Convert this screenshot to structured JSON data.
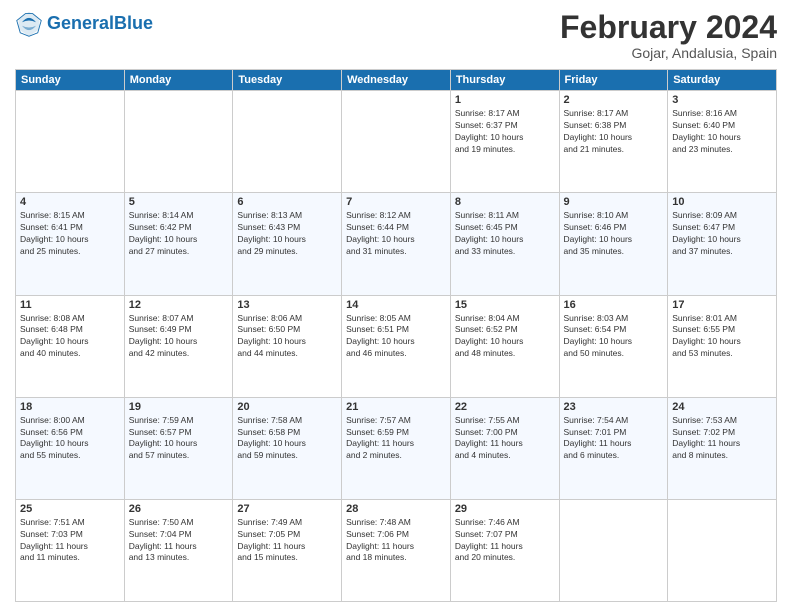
{
  "header": {
    "logo_general": "General",
    "logo_blue": "Blue",
    "month": "February 2024",
    "location": "Gojar, Andalusia, Spain"
  },
  "weekdays": [
    "Sunday",
    "Monday",
    "Tuesday",
    "Wednesday",
    "Thursday",
    "Friday",
    "Saturday"
  ],
  "rows": [
    [
      {
        "day": "",
        "info": ""
      },
      {
        "day": "",
        "info": ""
      },
      {
        "day": "",
        "info": ""
      },
      {
        "day": "",
        "info": ""
      },
      {
        "day": "1",
        "info": "Sunrise: 8:17 AM\nSunset: 6:37 PM\nDaylight: 10 hours\nand 19 minutes."
      },
      {
        "day": "2",
        "info": "Sunrise: 8:17 AM\nSunset: 6:38 PM\nDaylight: 10 hours\nand 21 minutes."
      },
      {
        "day": "3",
        "info": "Sunrise: 8:16 AM\nSunset: 6:40 PM\nDaylight: 10 hours\nand 23 minutes."
      }
    ],
    [
      {
        "day": "4",
        "info": "Sunrise: 8:15 AM\nSunset: 6:41 PM\nDaylight: 10 hours\nand 25 minutes."
      },
      {
        "day": "5",
        "info": "Sunrise: 8:14 AM\nSunset: 6:42 PM\nDaylight: 10 hours\nand 27 minutes."
      },
      {
        "day": "6",
        "info": "Sunrise: 8:13 AM\nSunset: 6:43 PM\nDaylight: 10 hours\nand 29 minutes."
      },
      {
        "day": "7",
        "info": "Sunrise: 8:12 AM\nSunset: 6:44 PM\nDaylight: 10 hours\nand 31 minutes."
      },
      {
        "day": "8",
        "info": "Sunrise: 8:11 AM\nSunset: 6:45 PM\nDaylight: 10 hours\nand 33 minutes."
      },
      {
        "day": "9",
        "info": "Sunrise: 8:10 AM\nSunset: 6:46 PM\nDaylight: 10 hours\nand 35 minutes."
      },
      {
        "day": "10",
        "info": "Sunrise: 8:09 AM\nSunset: 6:47 PM\nDaylight: 10 hours\nand 37 minutes."
      }
    ],
    [
      {
        "day": "11",
        "info": "Sunrise: 8:08 AM\nSunset: 6:48 PM\nDaylight: 10 hours\nand 40 minutes."
      },
      {
        "day": "12",
        "info": "Sunrise: 8:07 AM\nSunset: 6:49 PM\nDaylight: 10 hours\nand 42 minutes."
      },
      {
        "day": "13",
        "info": "Sunrise: 8:06 AM\nSunset: 6:50 PM\nDaylight: 10 hours\nand 44 minutes."
      },
      {
        "day": "14",
        "info": "Sunrise: 8:05 AM\nSunset: 6:51 PM\nDaylight: 10 hours\nand 46 minutes."
      },
      {
        "day": "15",
        "info": "Sunrise: 8:04 AM\nSunset: 6:52 PM\nDaylight: 10 hours\nand 48 minutes."
      },
      {
        "day": "16",
        "info": "Sunrise: 8:03 AM\nSunset: 6:54 PM\nDaylight: 10 hours\nand 50 minutes."
      },
      {
        "day": "17",
        "info": "Sunrise: 8:01 AM\nSunset: 6:55 PM\nDaylight: 10 hours\nand 53 minutes."
      }
    ],
    [
      {
        "day": "18",
        "info": "Sunrise: 8:00 AM\nSunset: 6:56 PM\nDaylight: 10 hours\nand 55 minutes."
      },
      {
        "day": "19",
        "info": "Sunrise: 7:59 AM\nSunset: 6:57 PM\nDaylight: 10 hours\nand 57 minutes."
      },
      {
        "day": "20",
        "info": "Sunrise: 7:58 AM\nSunset: 6:58 PM\nDaylight: 10 hours\nand 59 minutes."
      },
      {
        "day": "21",
        "info": "Sunrise: 7:57 AM\nSunset: 6:59 PM\nDaylight: 11 hours\nand 2 minutes."
      },
      {
        "day": "22",
        "info": "Sunrise: 7:55 AM\nSunset: 7:00 PM\nDaylight: 11 hours\nand 4 minutes."
      },
      {
        "day": "23",
        "info": "Sunrise: 7:54 AM\nSunset: 7:01 PM\nDaylight: 11 hours\nand 6 minutes."
      },
      {
        "day": "24",
        "info": "Sunrise: 7:53 AM\nSunset: 7:02 PM\nDaylight: 11 hours\nand 8 minutes."
      }
    ],
    [
      {
        "day": "25",
        "info": "Sunrise: 7:51 AM\nSunset: 7:03 PM\nDaylight: 11 hours\nand 11 minutes."
      },
      {
        "day": "26",
        "info": "Sunrise: 7:50 AM\nSunset: 7:04 PM\nDaylight: 11 hours\nand 13 minutes."
      },
      {
        "day": "27",
        "info": "Sunrise: 7:49 AM\nSunset: 7:05 PM\nDaylight: 11 hours\nand 15 minutes."
      },
      {
        "day": "28",
        "info": "Sunrise: 7:48 AM\nSunset: 7:06 PM\nDaylight: 11 hours\nand 18 minutes."
      },
      {
        "day": "29",
        "info": "Sunrise: 7:46 AM\nSunset: 7:07 PM\nDaylight: 11 hours\nand 20 minutes."
      },
      {
        "day": "",
        "info": ""
      },
      {
        "day": "",
        "info": ""
      }
    ]
  ]
}
